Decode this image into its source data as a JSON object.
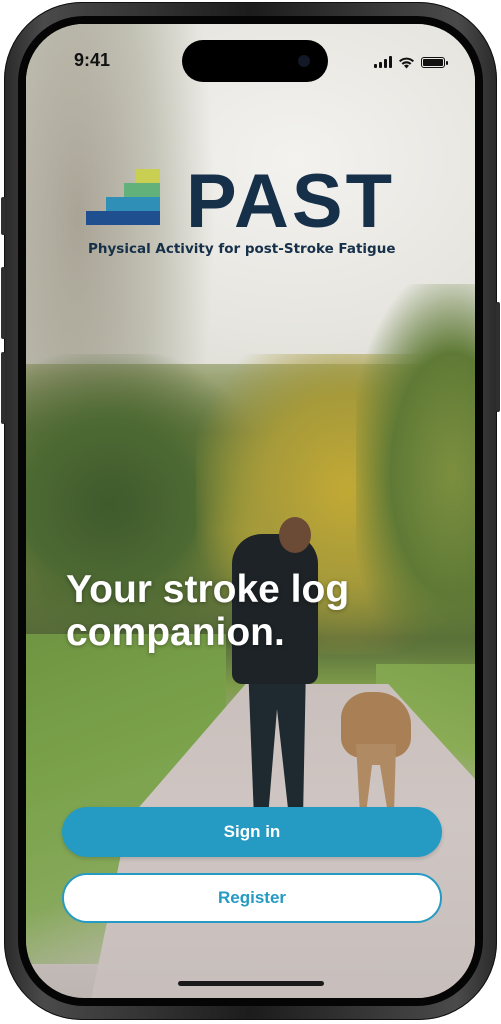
{
  "status_bar": {
    "time": "9:41",
    "icons": [
      "cellular-signal-icon",
      "wifi-icon",
      "battery-icon"
    ]
  },
  "logo": {
    "wordmark": "PAST",
    "tagline": "Physical Activity for post-Stroke Fatigue",
    "colors": {
      "wordmark": "#16304a",
      "bars": [
        "#c9cf52",
        "#63b17a",
        "#2f8fb6",
        "#1f4f8f"
      ]
    }
  },
  "hero": {
    "headline": "Your stroke log companion."
  },
  "actions": {
    "sign_in_label": "Sign in",
    "register_label": "Register"
  },
  "colors": {
    "accent": "#259ac2",
    "headline_text": "#ffffff"
  }
}
